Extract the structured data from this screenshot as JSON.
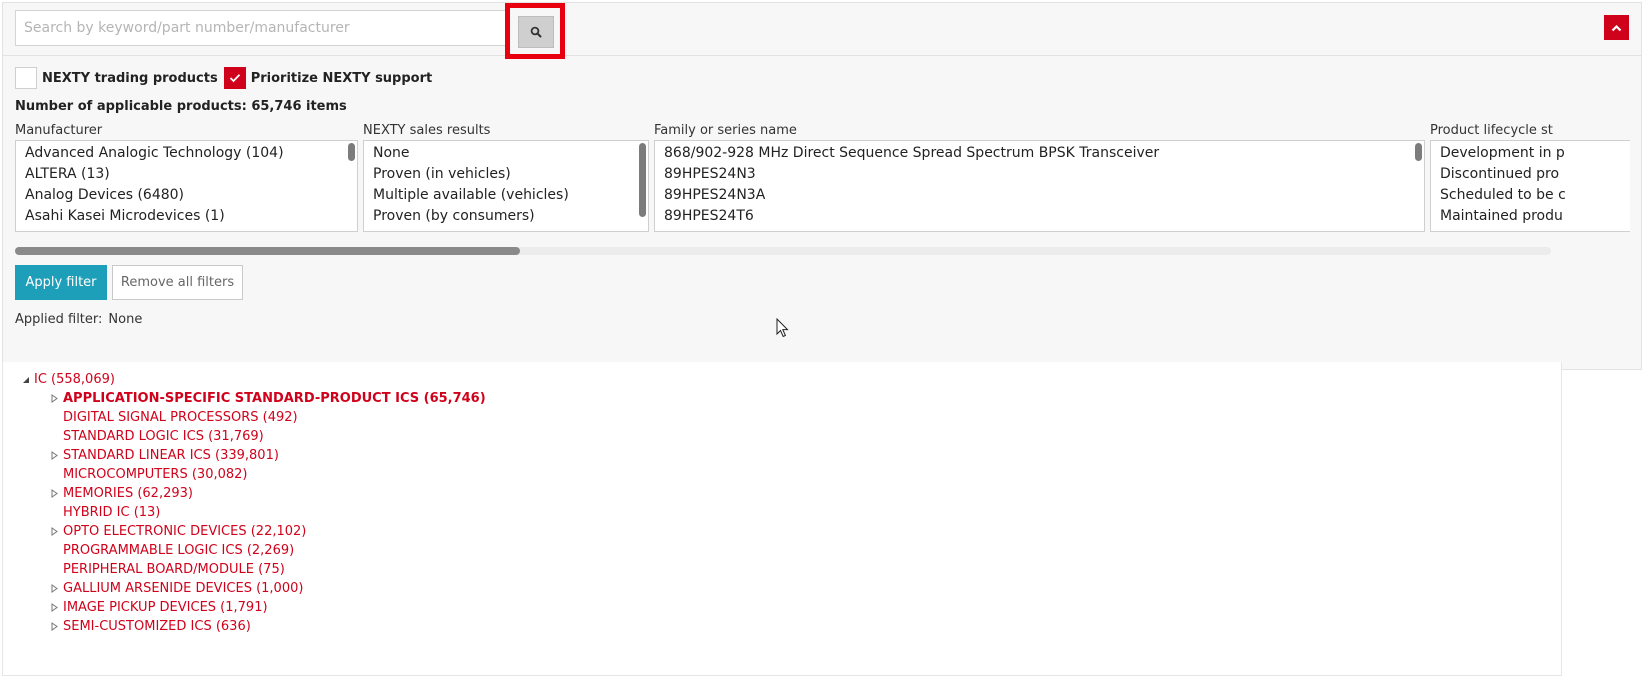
{
  "search": {
    "placeholder": "Search by keyword/part number/manufacturer"
  },
  "icons": {
    "search": "search-icon",
    "collapse": "chevron-up-icon",
    "checkmark": "check-icon",
    "expand": "triangle-right-icon",
    "collapse_tree": "triangle-down-icon"
  },
  "colors": {
    "accent_red": "#d0021b",
    "highlight_red": "#e8000e",
    "apply_teal": "#1d9fb9"
  },
  "checkboxes": [
    {
      "label": "NEXTY trading products",
      "checked": false
    },
    {
      "label": "Prioritize NEXTY support",
      "checked": true
    }
  ],
  "count_line": "Number of applicable products: 65,746 items",
  "filters": {
    "manufacturer": {
      "title": "Manufacturer",
      "options": [
        "Advanced Analogic Technology (104)",
        "ALTERA (13)",
        "Analog Devices (6480)",
        "Asahi Kasei Microdevices (1)"
      ]
    },
    "sales_results": {
      "title": "NEXTY sales results",
      "options": [
        "None",
        "Proven (in vehicles)",
        "Multiple available (vehicles)",
        "Proven (by consumers)"
      ]
    },
    "family": {
      "title": "Family or series name",
      "options": [
        "868/902-928 MHz Direct Sequence Spread Spectrum BPSK Transceiver",
        "89HPES24N3",
        "89HPES24N3A",
        "89HPES24T6"
      ]
    },
    "lifecycle": {
      "title": "Product lifecycle st",
      "options": [
        "Development in p",
        "Discontinued pro",
        "Scheduled to be c",
        "Maintained produ"
      ]
    }
  },
  "buttons": {
    "apply": "Apply filter",
    "remove": "Remove all filters"
  },
  "applied_filter": {
    "label": "Applied filter:",
    "value": "None"
  },
  "tree": {
    "root": {
      "label": "IC (558,069)",
      "expanded": true
    },
    "children": [
      {
        "label": "APPLICATION-SPECIFIC STANDARD-PRODUCT ICS (65,746)",
        "expandable": true,
        "selected": true
      },
      {
        "label": "DIGITAL SIGNAL PROCESSORS (492)",
        "expandable": false
      },
      {
        "label": "STANDARD LOGIC ICS (31,769)",
        "expandable": false
      },
      {
        "label": "STANDARD LINEAR ICS (339,801)",
        "expandable": true
      },
      {
        "label": "MICROCOMPUTERS (30,082)",
        "expandable": false
      },
      {
        "label": "MEMORIES (62,293)",
        "expandable": true
      },
      {
        "label": "HYBRID IC (13)",
        "expandable": false
      },
      {
        "label": "OPTO ELECTRONIC DEVICES (22,102)",
        "expandable": true
      },
      {
        "label": "PROGRAMMABLE LOGIC ICS (2,269)",
        "expandable": false
      },
      {
        "label": "PERIPHERAL BOARD/MODULE (75)",
        "expandable": false
      },
      {
        "label": "GALLIUM ARSENIDE DEVICES (1,000)",
        "expandable": true
      },
      {
        "label": "IMAGE PICKUP DEVICES (1,791)",
        "expandable": true
      },
      {
        "label": "SEMI-CUSTOMIZED ICS (636)",
        "expandable": true
      }
    ]
  }
}
